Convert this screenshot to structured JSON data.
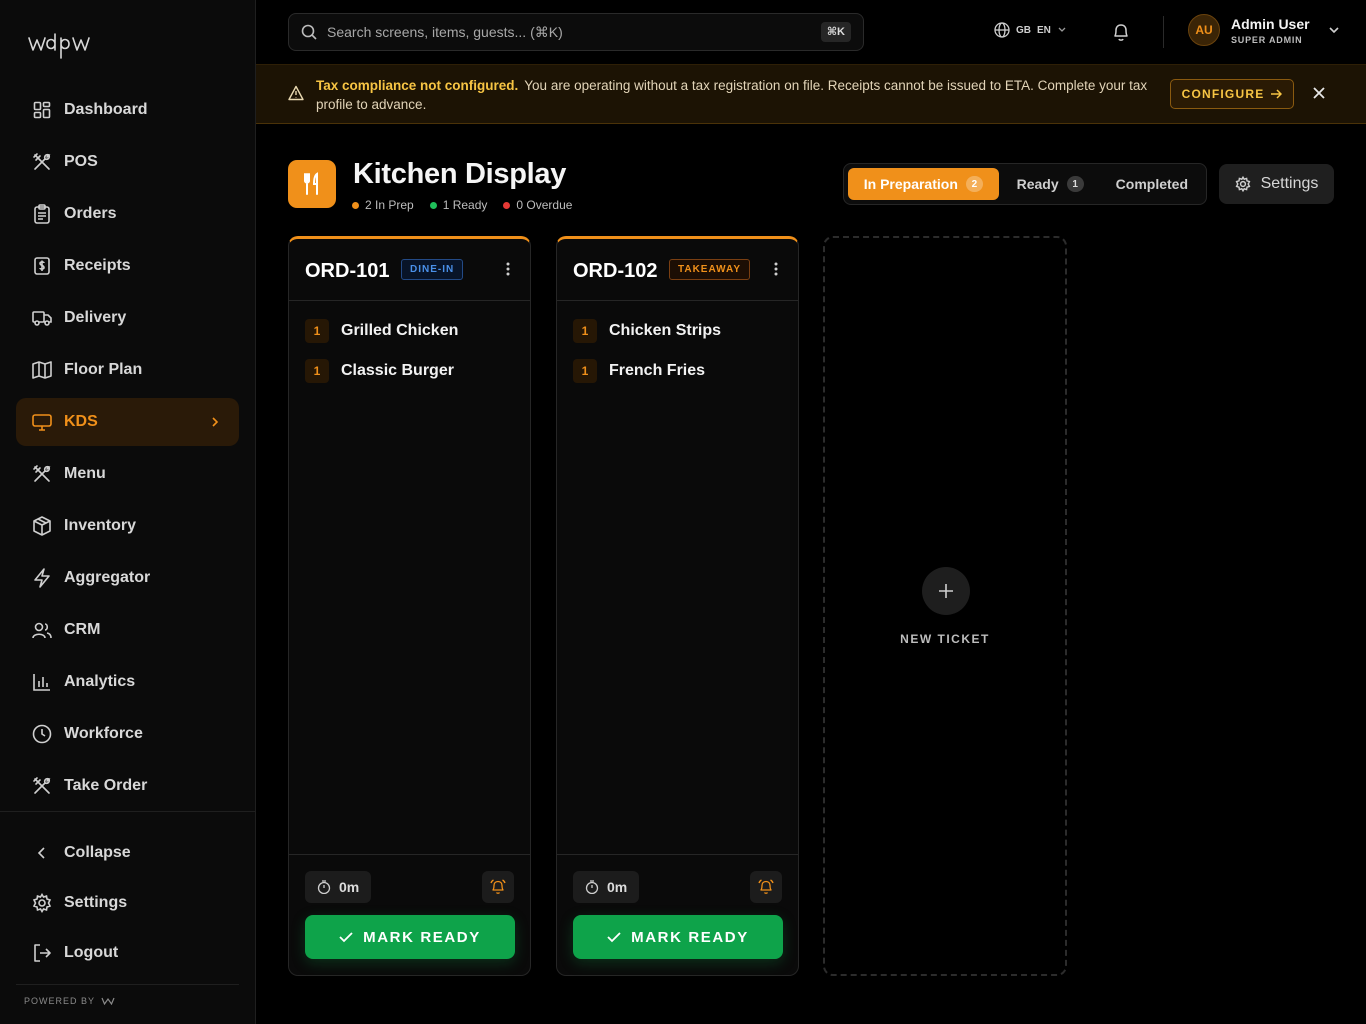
{
  "brand": {
    "logo_text": "wdpw",
    "accent": "#f0901a",
    "success": "#0ea34a"
  },
  "sidebar": {
    "items": [
      {
        "label": "Dashboard",
        "icon": "dashboard-icon"
      },
      {
        "label": "POS",
        "icon": "utensils-cross-icon"
      },
      {
        "label": "Orders",
        "icon": "clipboard-icon"
      },
      {
        "label": "Receipts",
        "icon": "receipt-icon"
      },
      {
        "label": "Delivery",
        "icon": "truck-icon"
      },
      {
        "label": "Floor Plan",
        "icon": "map-icon"
      },
      {
        "label": "KDS",
        "icon": "monitor-icon",
        "active": true
      },
      {
        "label": "Menu",
        "icon": "utensils-cross-icon"
      },
      {
        "label": "Inventory",
        "icon": "box-icon"
      },
      {
        "label": "Aggregator",
        "icon": "bolt-icon"
      },
      {
        "label": "CRM",
        "icon": "users-icon"
      },
      {
        "label": "Analytics",
        "icon": "bar-chart-icon"
      },
      {
        "label": "Workforce",
        "icon": "clock-icon"
      },
      {
        "label": "Take Order",
        "icon": "utensils-cross-icon"
      }
    ],
    "bottom": {
      "collapse": "Collapse",
      "settings": "Settings",
      "logout": "Logout"
    },
    "powered_by": "POWERED BY"
  },
  "topbar": {
    "search_placeholder": "Search screens, items, guests... (⌘K)",
    "shortcut": "⌘K",
    "lang_region": "GB",
    "lang_code": "EN",
    "user": {
      "initials": "AU",
      "name": "Admin User",
      "role": "SUPER ADMIN"
    }
  },
  "banner": {
    "title": "Tax compliance not configured.",
    "message": "You are operating without a tax registration on file. Receipts cannot be issued to ETA. Complete your tax profile to advance.",
    "action": "CONFIGURE"
  },
  "page": {
    "title": "Kitchen Display",
    "stats": [
      {
        "label": "2 In Prep",
        "color": "#f0901a"
      },
      {
        "label": "1 Ready",
        "color": "#1fbf5a"
      },
      {
        "label": "0 Overdue",
        "color": "#e53935"
      }
    ],
    "tabs": [
      {
        "label": "In Preparation",
        "count": "2",
        "active": true
      },
      {
        "label": "Ready",
        "count": "1"
      },
      {
        "label": "Completed"
      }
    ],
    "settings_label": "Settings"
  },
  "tickets": [
    {
      "id": "ORD-101",
      "type": "DINE-IN",
      "items": [
        {
          "qty": "1",
          "name": "Grilled Chicken"
        },
        {
          "qty": "1",
          "name": "Classic Burger"
        }
      ],
      "timer": "0m",
      "action": "MARK READY"
    },
    {
      "id": "ORD-102",
      "type": "TAKEAWAY",
      "items": [
        {
          "qty": "1",
          "name": "Chicken Strips"
        },
        {
          "qty": "1",
          "name": "French Fries"
        }
      ],
      "timer": "0m",
      "action": "MARK READY"
    }
  ],
  "new_ticket_label": "NEW TICKET"
}
